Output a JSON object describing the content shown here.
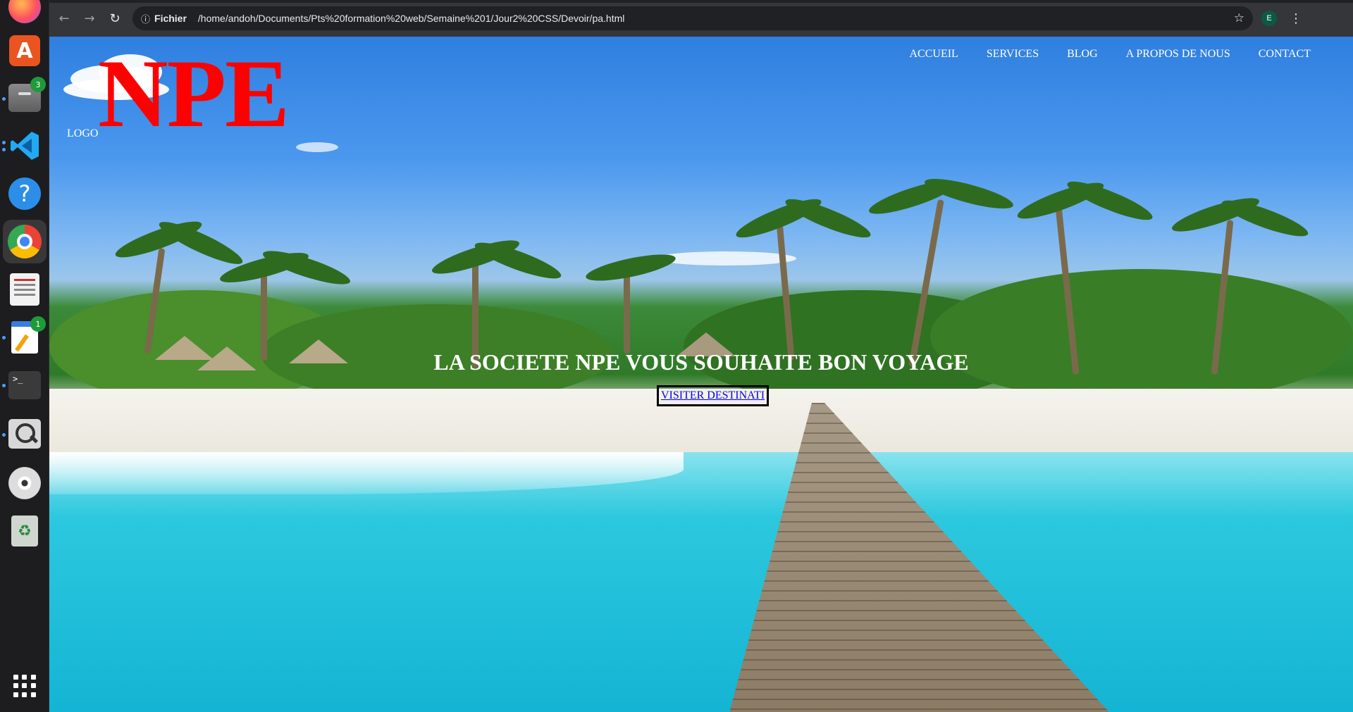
{
  "dock": {
    "items": [
      {
        "name": "firefox"
      },
      {
        "name": "app-center",
        "glyph": "A"
      },
      {
        "name": "files",
        "badge": "3"
      },
      {
        "name": "vscode"
      },
      {
        "name": "help",
        "glyph": "?"
      },
      {
        "name": "chrome"
      },
      {
        "name": "document-viewer"
      },
      {
        "name": "text-editor",
        "badge": "1"
      },
      {
        "name": "terminal",
        "glyph": ">_"
      },
      {
        "name": "search"
      },
      {
        "name": "disc"
      },
      {
        "name": "trash",
        "glyph": "♻"
      }
    ]
  },
  "browser": {
    "omnibox": {
      "scheme_label": "Fichier",
      "url": "/home/andoh/Documents/Pts%20formation%20web/Semaine%201/Jour2%20CSS/Devoir/pa.html"
    },
    "profile_initial": "E"
  },
  "page": {
    "logo_label": "LOGO",
    "logo_text": "NPE",
    "nav": [
      "ACCUEIL",
      "SERVICES",
      "BLOG",
      "A PROPOS DE NOUS",
      "CONTACT"
    ],
    "hero_title": "LA SOCIETE NPE VOUS SOUHAITE BON VOYAGE",
    "hero_button": "VISITER DESTINATI",
    "colors": {
      "logo": "#ff0000",
      "nav_text": "#ffffff",
      "link": "#0000ee"
    }
  }
}
